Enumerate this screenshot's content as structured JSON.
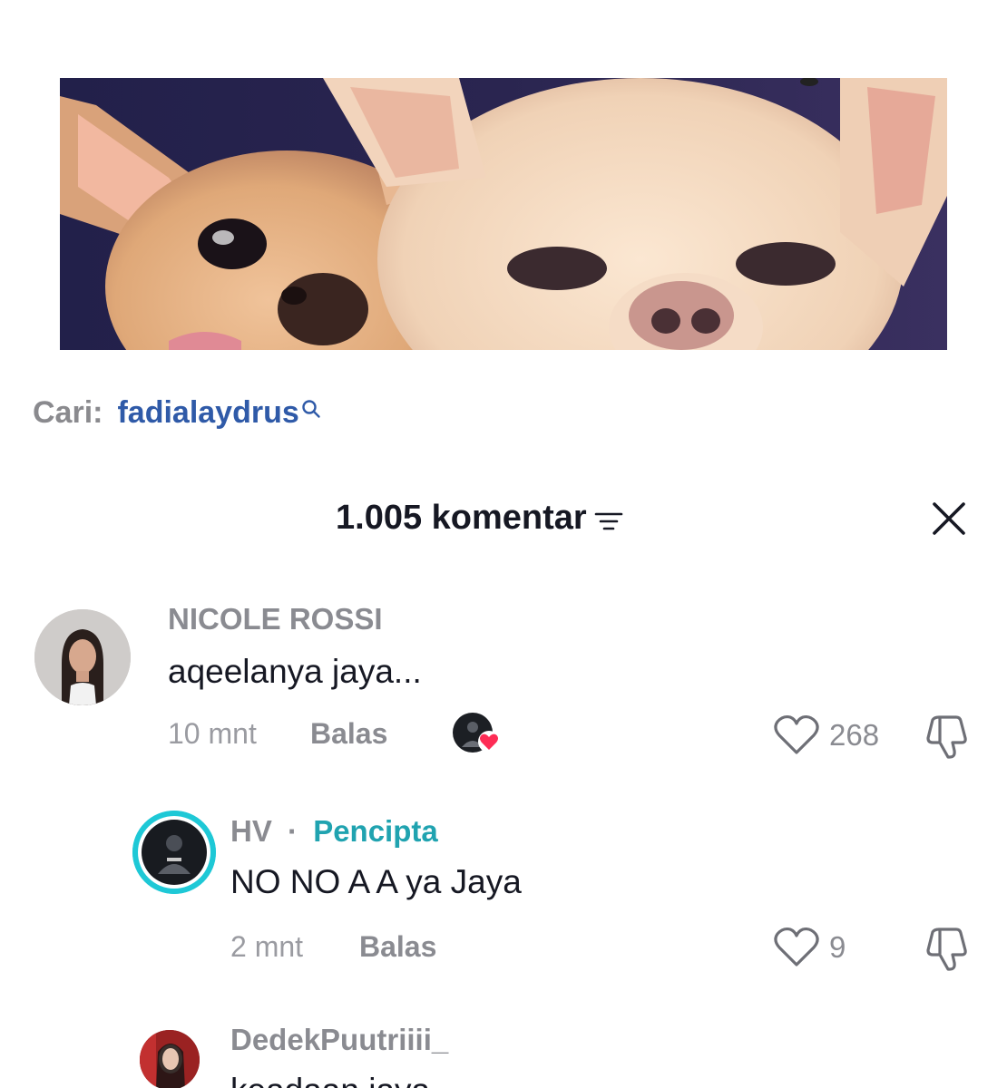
{
  "search": {
    "prefix": "Cari:",
    "term": "fadialaydrus"
  },
  "comments_header": {
    "title": "1.005 komentar"
  },
  "comments": [
    {
      "username": "NICOLE ROSSI",
      "text": "aqeelanya jaya...",
      "time": "10 mnt",
      "reply_label": "Balas",
      "likes": "268",
      "liked_by_creator": true
    },
    {
      "username": "HV",
      "separator": "·",
      "badge": "Pencipta",
      "text": "NO NO A A ya Jaya",
      "time": "2 mnt",
      "reply_label": "Balas",
      "likes": "9"
    },
    {
      "username": "DedekPuutriiii_",
      "text": "keadaan jaya"
    }
  ],
  "colors": {
    "creator_badge": "#20a3b0",
    "search_term": "#2f5aa8",
    "heart_badge": "#fe2c55",
    "creator_ring": "#1ec8d6"
  },
  "icons": {
    "search": "search-icon",
    "filter": "filter-icon",
    "close": "close-icon",
    "heart": "heart-outline-icon",
    "dislike": "thumbs-down-icon"
  }
}
